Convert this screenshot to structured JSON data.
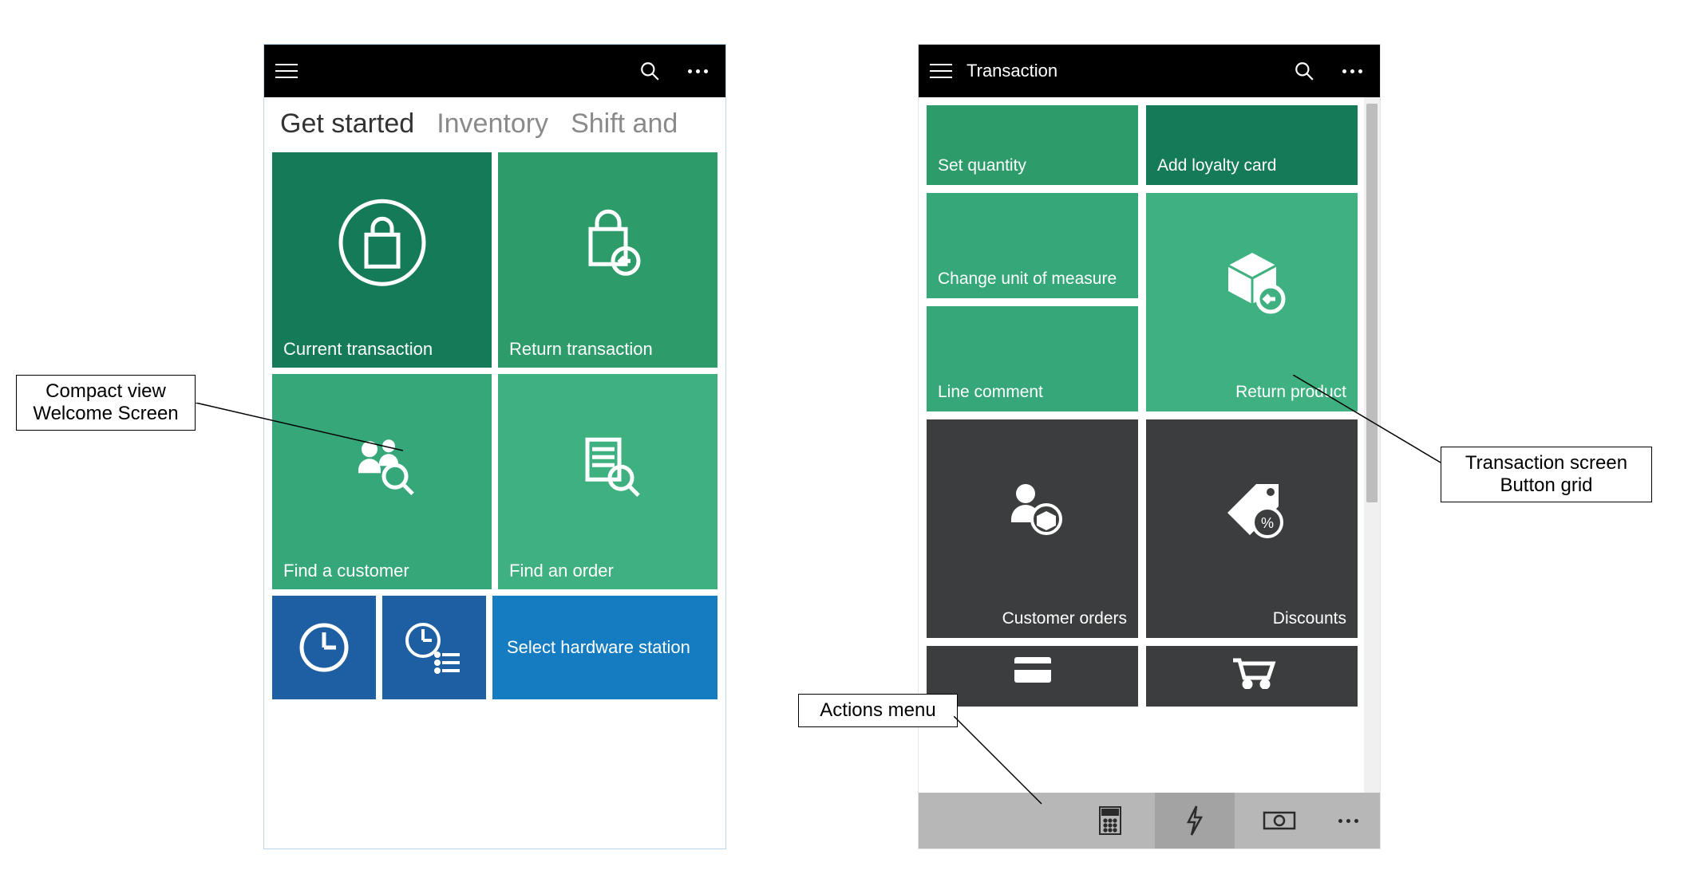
{
  "left": {
    "tabs": {
      "t1": "Get started",
      "t2": "Inventory",
      "t3": "Shift and"
    },
    "tiles": {
      "current_transaction": "Current transaction",
      "return_transaction": "Return transaction",
      "find_customer": "Find a customer",
      "find_order": "Find an order",
      "select_hw": "Select hardware station"
    }
  },
  "right": {
    "title": "Transaction",
    "tiles": {
      "set_qty": "Set quantity",
      "add_loyalty": "Add loyalty card",
      "change_uom": "Change unit of measure",
      "line_comment": "Line comment",
      "return_product": "Return product",
      "customer_orders": "Customer orders",
      "discounts": "Discounts"
    }
  },
  "annotations": {
    "welcome": "Compact view Welcome Screen",
    "txn_grid": "Transaction screen Button grid",
    "actions": "Actions menu"
  }
}
